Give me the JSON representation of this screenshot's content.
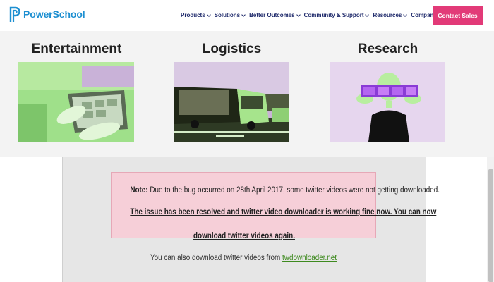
{
  "nav": {
    "logo_text": "PowerSchool",
    "items": [
      {
        "label": "Products"
      },
      {
        "label": "Solutions"
      },
      {
        "label": "Better Outcomes"
      },
      {
        "label": "Community & Support"
      },
      {
        "label": "Resources"
      },
      {
        "label": "Company"
      }
    ],
    "cta_label": "Contact Sales"
  },
  "mega_menu": {
    "columns": [
      {
        "title": "Entertainment",
        "image": "tablet-hands-photo"
      },
      {
        "title": "Logistics",
        "image": "truck-photo"
      },
      {
        "title": "Research",
        "image": "person-holding-film-photo"
      }
    ]
  },
  "notice": {
    "note_label": "Note:",
    "line1": "Due to the bug occurred on 28th April 2017, some twitter videos were not getting downloaded.",
    "line2": "The issue has been resolved and twitter video downloader is working fine now. You can now",
    "line3": "download twitter videos again."
  },
  "also": {
    "text": "You can also download twitter videos from ",
    "link_text": "twdownloader.net"
  },
  "colors": {
    "brand_blue": "#1d8fd1",
    "nav_text": "#1f2a6b",
    "cta_pink": "#e23a78",
    "notice_bg": "#f6cfd8",
    "link_green": "#3e8a1f"
  }
}
